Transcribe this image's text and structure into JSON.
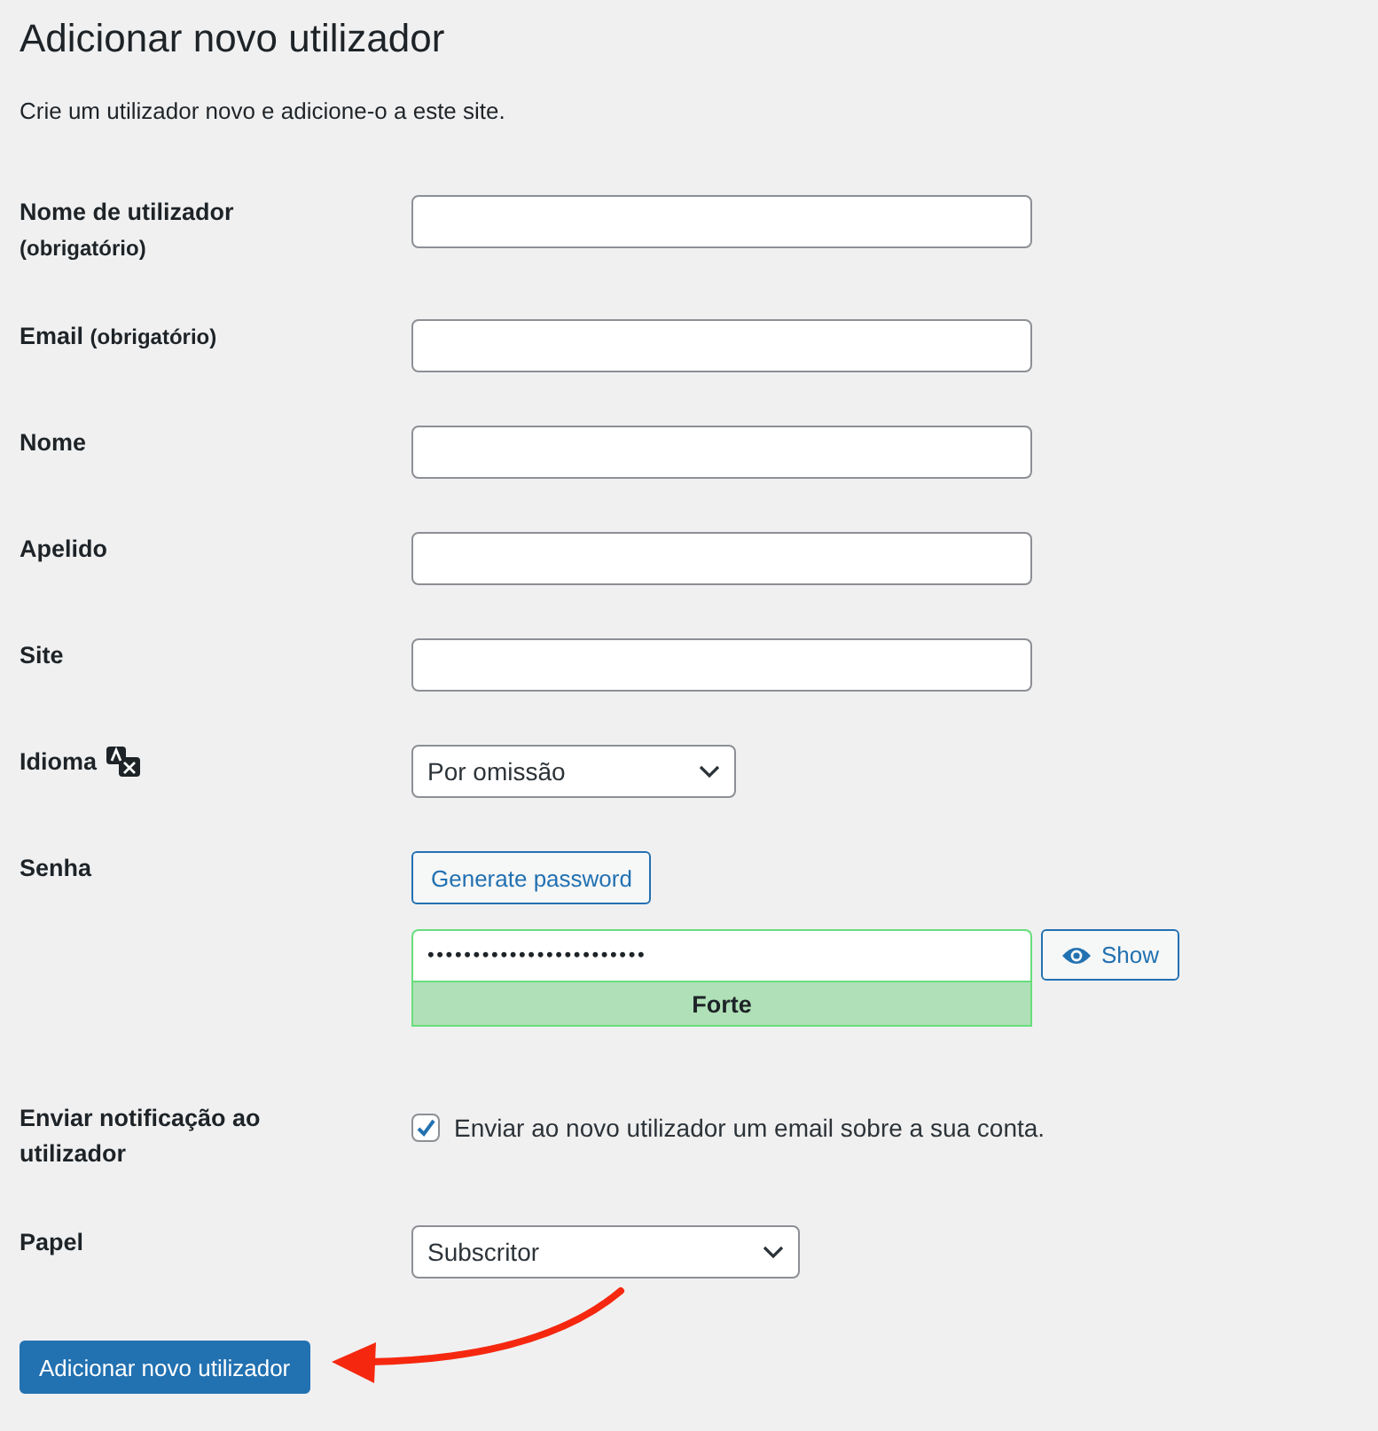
{
  "title": "Adicionar novo utilizador",
  "description": "Crie um utilizador novo e adicione-o a este site.",
  "fields": [
    {
      "kind": "text",
      "label": "Nome de utilizador",
      "note": "(obrigatório)"
    },
    {
      "kind": "text",
      "label": "Email",
      "note": "(obrigatório)"
    },
    {
      "kind": "text",
      "label": "Nome"
    },
    {
      "kind": "text",
      "label": "Apelido"
    },
    {
      "kind": "text",
      "label": "Site"
    },
    {
      "kind": "select",
      "label": "Idioma",
      "translate_icon": true,
      "value": "Por omissão"
    },
    {
      "kind": "password",
      "label": "Senha",
      "generate": "Generate password",
      "value": "••••••••••••••••••••••••",
      "show": "Show",
      "strength": {
        "kind": "strong",
        "label": "Forte"
      }
    },
    {
      "kind": "checkbox",
      "label": "Enviar notificação ao utilizador",
      "checked": true,
      "text": "Enviar ao novo utilizador um email sobre a sua conta."
    },
    {
      "kind": "select",
      "label": "Papel",
      "value": "Subscritor",
      "wide": true
    }
  ],
  "submit": "Adicionar novo utilizador"
}
